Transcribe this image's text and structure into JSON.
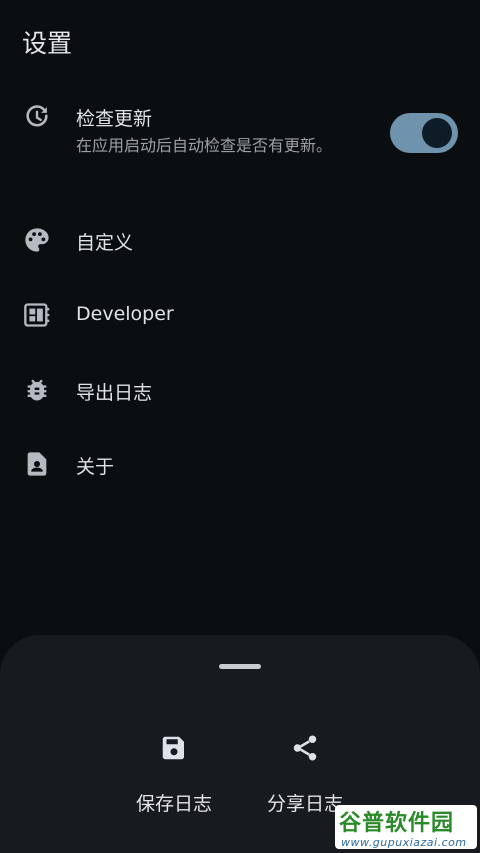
{
  "header": {
    "title": "设置"
  },
  "settings": {
    "items": [
      {
        "icon": "update-history-icon",
        "label": "检查更新",
        "description": "在应用启动后自动检查是否有更新。",
        "toggle_on": true
      },
      {
        "icon": "palette-icon",
        "label": "自定义"
      },
      {
        "icon": "developer-board-icon",
        "label": "Developer"
      },
      {
        "icon": "bug-icon",
        "label": "导出日志"
      },
      {
        "icon": "contact-document-icon",
        "label": "关于"
      }
    ]
  },
  "bottom_sheet": {
    "actions": [
      {
        "icon": "save-icon",
        "label": "保存日志"
      },
      {
        "icon": "share-icon",
        "label": "分享日志"
      }
    ]
  },
  "watermark": {
    "name": "谷普软件园",
    "url": "www.gupuxiazai.com"
  },
  "colors": {
    "background": "#0b0e11",
    "sheet": "#171b20",
    "toggle_track": "#6f93ad",
    "toggle_thumb": "#0e1c28",
    "icon": "#b6bac0"
  }
}
